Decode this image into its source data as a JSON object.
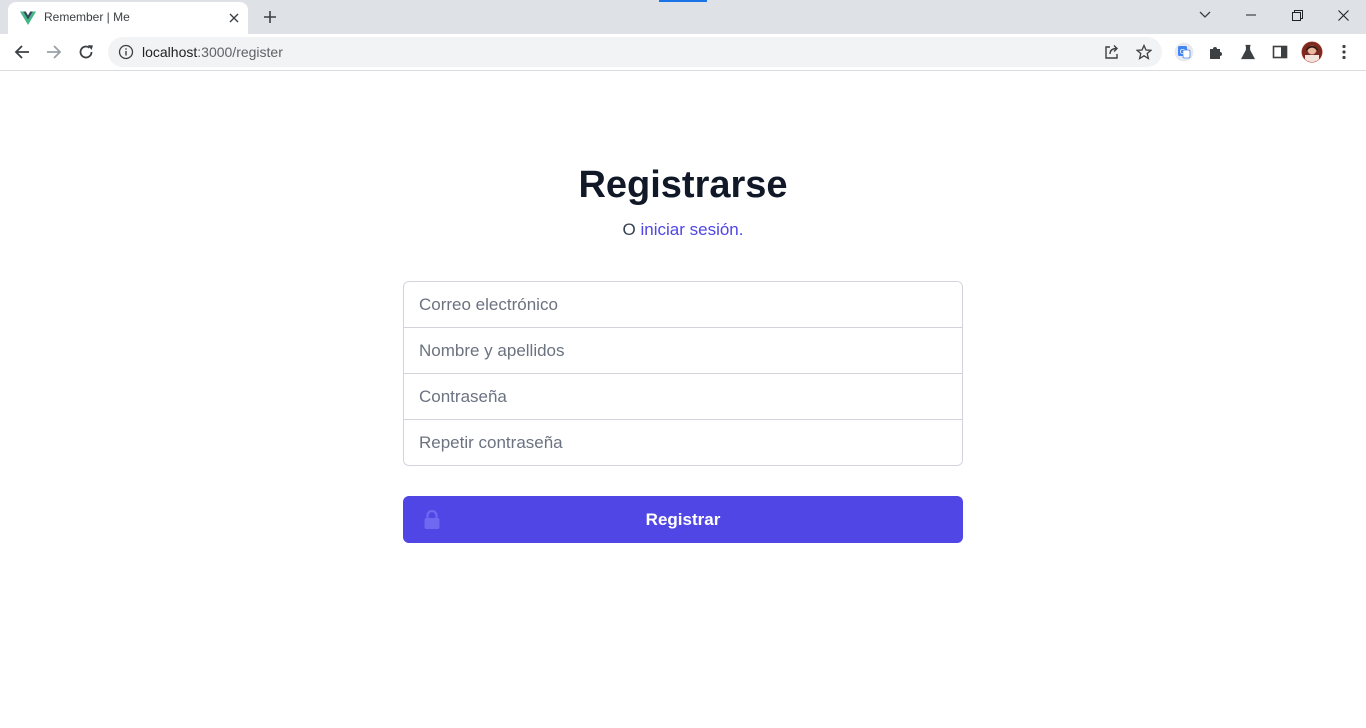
{
  "browser": {
    "tab_title": "Remember | Me",
    "url_host": "localhost",
    "url_path": ":3000/register",
    "accent_color": "#1a73e8",
    "icons": [
      "vue-favicon",
      "close-icon",
      "plus-icon",
      "chevron-down-icon",
      "minimize-icon",
      "restore-icon",
      "close-window-icon",
      "back-arrow-icon",
      "forward-arrow-icon",
      "reload-icon",
      "info-icon",
      "share-icon",
      "star-icon",
      "translate-icon",
      "puzzle-icon",
      "flask-icon",
      "side-panel-icon",
      "avatar",
      "kebab-menu-icon"
    ]
  },
  "page": {
    "title": "Registrarse",
    "subtitle_prefix": "O",
    "login_link": "iniciar sesión.",
    "link_color": "#4f46e5"
  },
  "form": {
    "email_placeholder": "Correo electrónico",
    "name_placeholder": "Nombre y apellidos",
    "password_placeholder": "Contraseña",
    "repeat_password_placeholder": "Repetir contraseña",
    "submit_label": "Registrar",
    "submit_color": "#4f46e5",
    "submit_icon": "lock-icon"
  }
}
